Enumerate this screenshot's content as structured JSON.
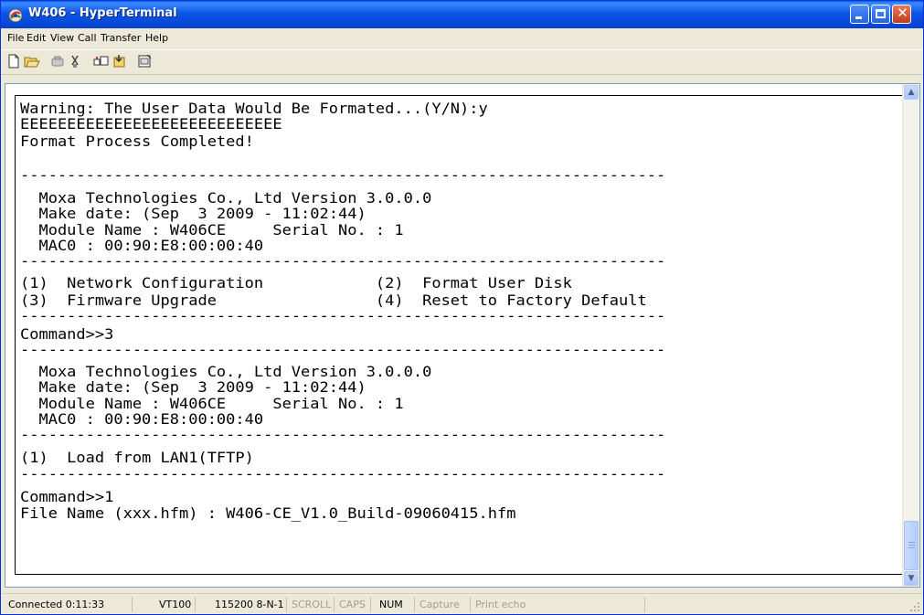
{
  "window": {
    "title": "W406 - HyperTerminal"
  },
  "menu": {
    "file": "File",
    "edit": "Edit",
    "view": "View",
    "call": "Call",
    "transfer": "Transfer",
    "help": "Help"
  },
  "toolbar": {
    "icons": [
      "new-document-icon",
      "open-folder-icon",
      "connect-icon",
      "disconnect-icon",
      "send-icon",
      "receive-icon",
      "properties-icon"
    ]
  },
  "terminal": {
    "lines": [
      "Warning: The User Data Would Be Formated...(Y/N):y",
      "EEEEEEEEEEEEEEEEEEEEEEEEEEEE",
      "Format Process Completed!",
      "",
      "---------------------------------------------------------------------",
      "  Moxa Technologies Co., Ltd Version 3.0.0.0",
      "  Make date: (Sep  3 2009 - 11:02:44)",
      "  Module Name : W406CE     Serial No. : 1",
      "  MAC0 : 00:90:E8:00:00:40",
      "---------------------------------------------------------------------",
      "(1)  Network Configuration            (2)  Format User Disk",
      "(3)  Firmware Upgrade                 (4)  Reset to Factory Default",
      "---------------------------------------------------------------------",
      "Command>>3",
      "---------------------------------------------------------------------",
      "  Moxa Technologies Co., Ltd Version 3.0.0.0",
      "  Make date: (Sep  3 2009 - 11:02:44)",
      "  Module Name : W406CE     Serial No. : 1",
      "  MAC0 : 00:90:E8:00:00:40",
      "---------------------------------------------------------------------",
      "(1)  Load from LAN1(TFTP)",
      "---------------------------------------------------------------------",
      "Command>>1",
      "File Name (xxx.hfm) : W406-CE_V1.0_Build-09060415.hfm"
    ]
  },
  "status": {
    "connected": "Connected 0:11:33",
    "emulation": "VT100",
    "port_settings": "115200 8-N-1",
    "scroll": "SCROLL",
    "caps": "CAPS",
    "num": "NUM",
    "capture": "Capture",
    "print_echo": "Print echo"
  }
}
